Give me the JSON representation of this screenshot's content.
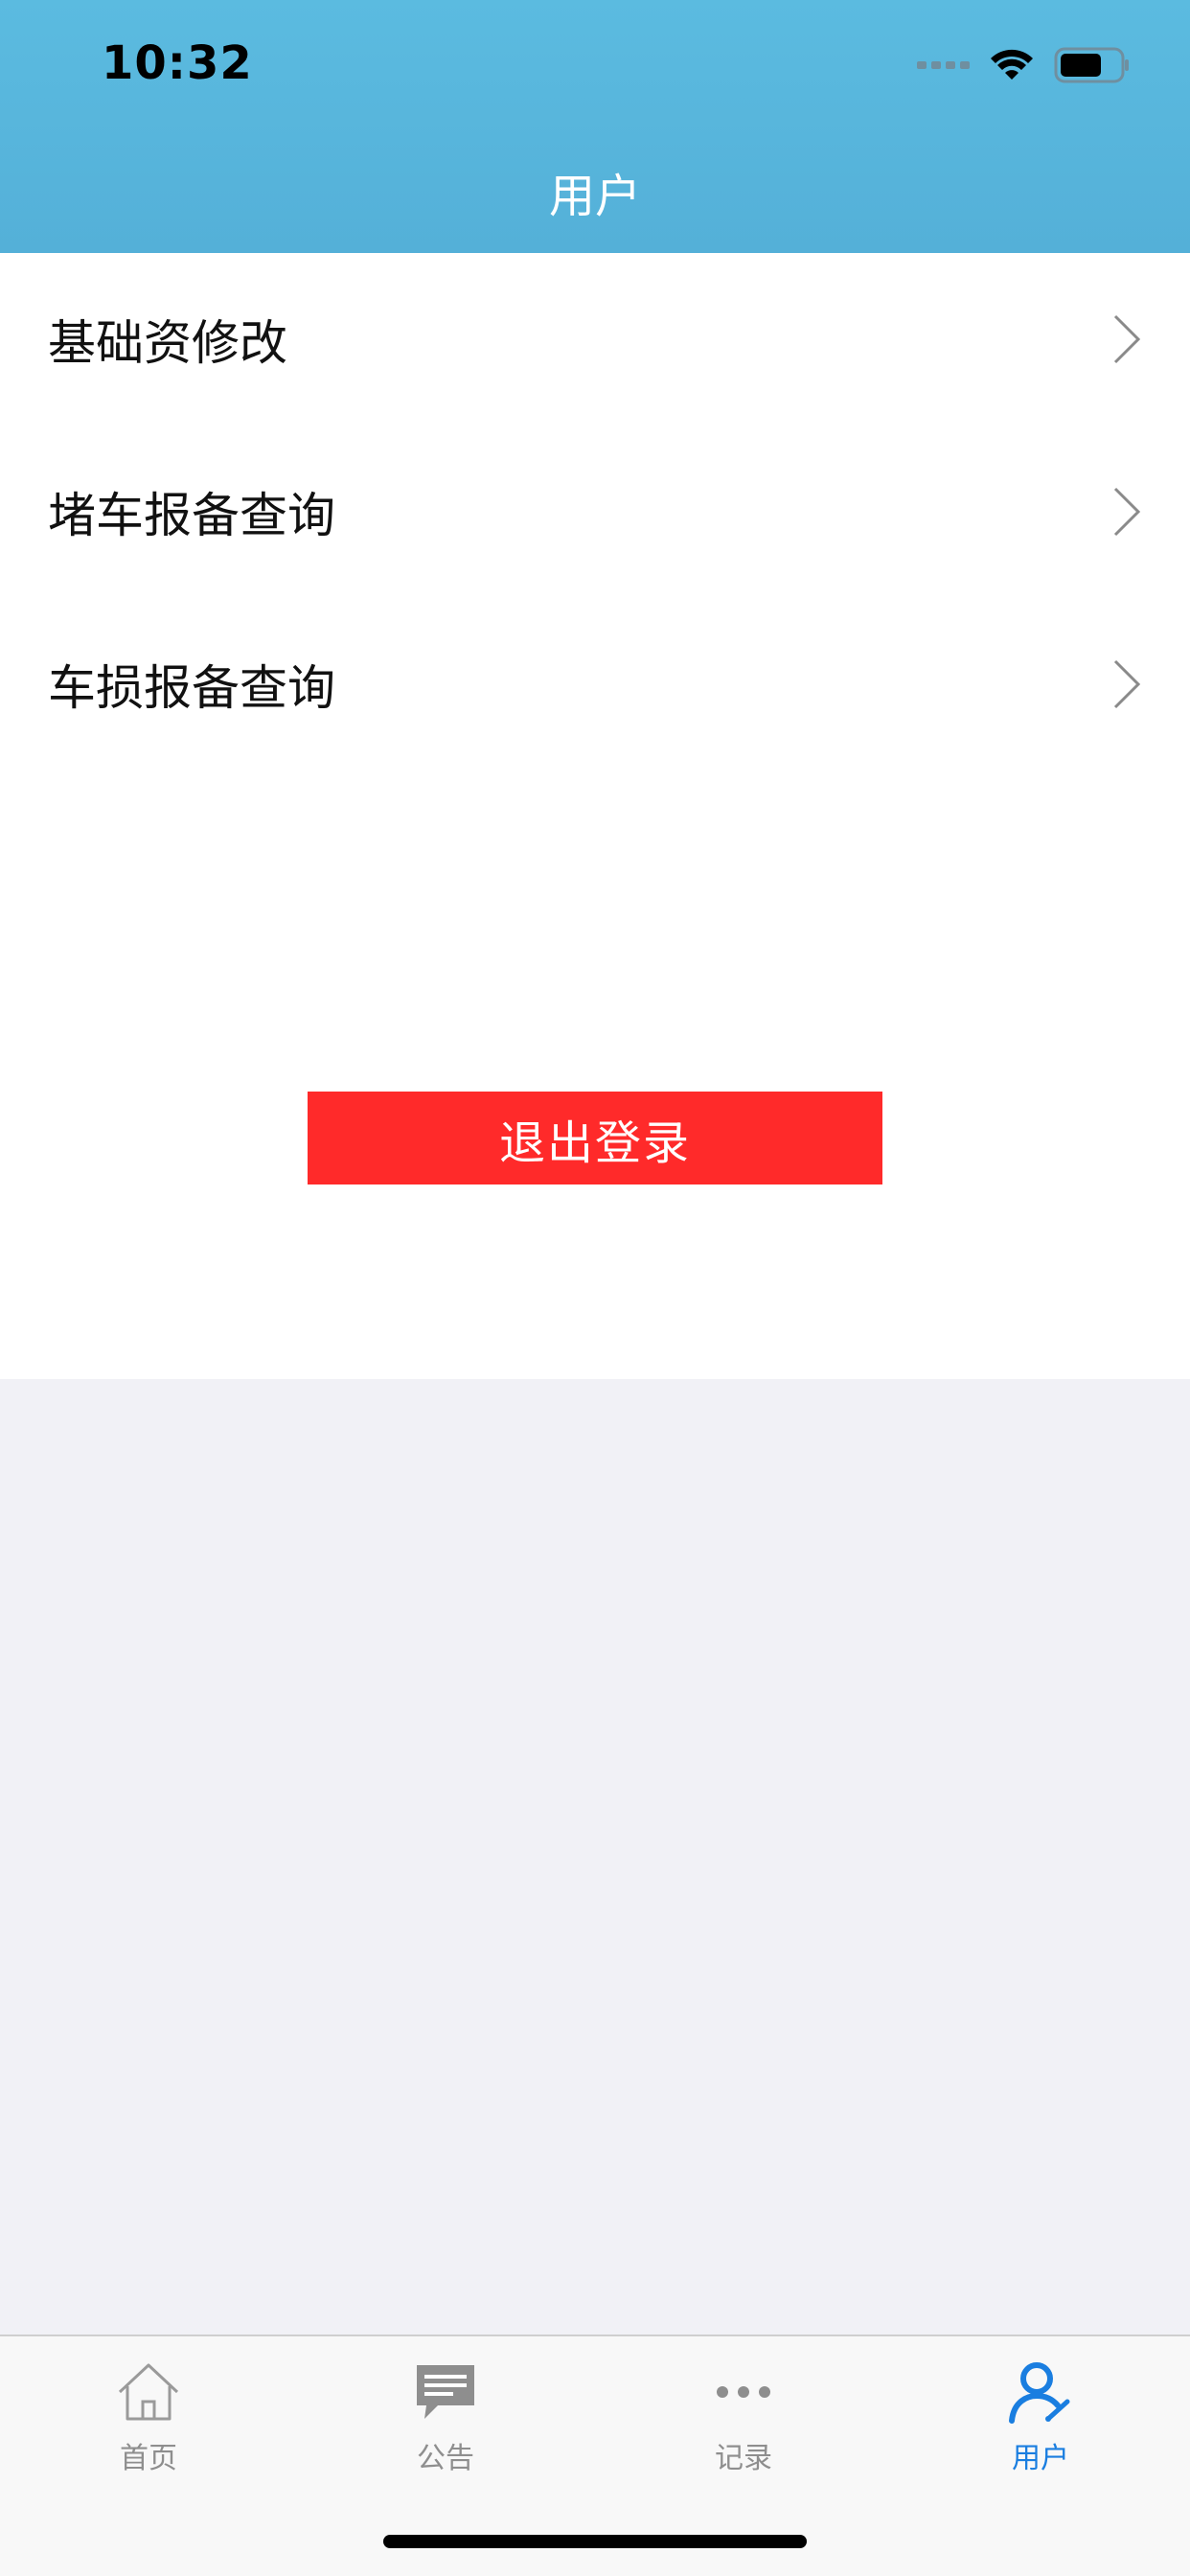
{
  "status_bar": {
    "time": "10:32",
    "icons": [
      "signal-dots-icon",
      "wifi-icon",
      "battery-icon"
    ]
  },
  "nav": {
    "title": "用户"
  },
  "menu": {
    "items": [
      {
        "label": "基础资修改"
      },
      {
        "label": "堵车报备查询"
      },
      {
        "label": "车损报备查询"
      }
    ]
  },
  "actions": {
    "logout_label": "退出登录"
  },
  "tabbar": {
    "tabs": [
      {
        "label": "首页",
        "icon": "home-icon",
        "active": false
      },
      {
        "label": "公告",
        "icon": "message-icon",
        "active": false
      },
      {
        "label": "记录",
        "icon": "ellipsis-icon",
        "active": false
      },
      {
        "label": "用户",
        "icon": "user-edit-icon",
        "active": true
      }
    ]
  },
  "colors": {
    "header": "#5bbbe0",
    "logout": "#ff2a2a",
    "active_tab": "#1a7ee0",
    "inactive_tab": "#8e8e8e",
    "background": "#f1f1f6"
  }
}
